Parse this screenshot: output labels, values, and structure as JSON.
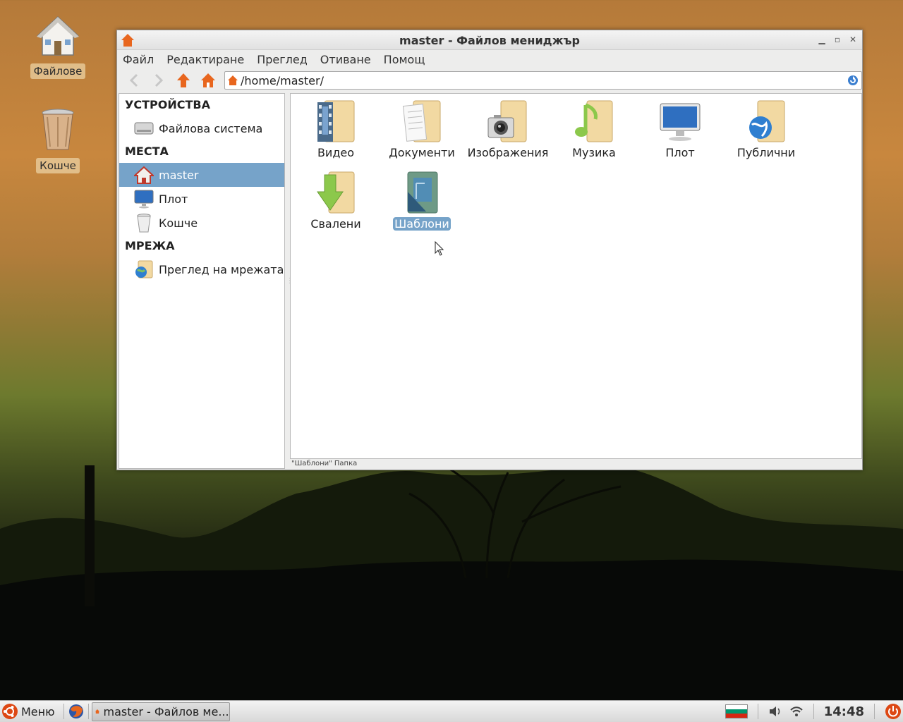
{
  "desktop": {
    "icons": [
      {
        "label": "Файлове",
        "icon": "home-icon"
      },
      {
        "label": "Кошче",
        "icon": "trash-icon"
      }
    ]
  },
  "window": {
    "title": "master - Файлов мениджър",
    "menu": [
      "Файл",
      "Редактиране",
      "Преглед",
      "Отиване",
      "Помощ"
    ],
    "path": "/home/master/",
    "sidebar": {
      "devices_header": "УСТРОЙСТВА",
      "devices": [
        {
          "label": "Файлова система",
          "icon": "drive-icon"
        }
      ],
      "places_header": "МЕСТА",
      "places": [
        {
          "label": "master",
          "icon": "home-icon",
          "selected": true
        },
        {
          "label": "Плот",
          "icon": "desktop-icon"
        },
        {
          "label": "Кошче",
          "icon": "trash-icon"
        }
      ],
      "network_header": "МРЕЖА",
      "network": [
        {
          "label": "Преглед на мрежата",
          "icon": "network-icon"
        }
      ]
    },
    "files": [
      {
        "label": "Видео",
        "icon": "video-folder-icon"
      },
      {
        "label": "Документи",
        "icon": "documents-folder-icon"
      },
      {
        "label": "Изображения",
        "icon": "pictures-folder-icon"
      },
      {
        "label": "Музика",
        "icon": "music-folder-icon"
      },
      {
        "label": "Плот",
        "icon": "desktop-folder-icon"
      },
      {
        "label": "Публични",
        "icon": "public-folder-icon"
      },
      {
        "label": "Свалени",
        "icon": "downloads-folder-icon"
      },
      {
        "label": "Шаблони",
        "icon": "templates-folder-icon",
        "selected": true
      }
    ],
    "status": "\"Шаблони\" Папка"
  },
  "taskbar": {
    "menu_label": "Меню",
    "task_label": "master - Файлов ме...",
    "clock": "14:48"
  },
  "colors": {
    "selection": "#76a3c9",
    "accent_orange": "#e8661e",
    "folder": "#f2d9a2"
  }
}
